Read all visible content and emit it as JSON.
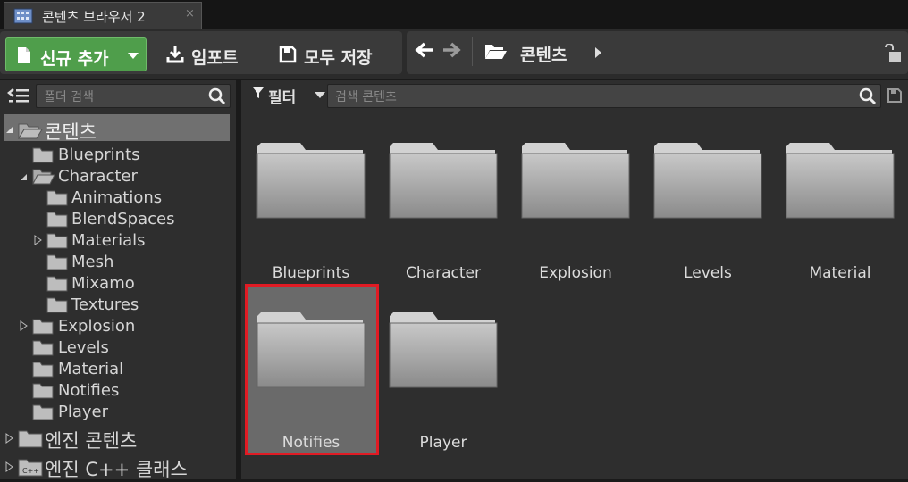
{
  "tab": {
    "title": "콘텐츠 브라우저 2",
    "close": "×"
  },
  "toolbar": {
    "new_label": "신규 추가",
    "import_label": "임포트",
    "save_all_label": "모두 저장",
    "breadcrumb": "콘텐츠"
  },
  "left": {
    "search_placeholder": "폴더 검색",
    "tree": [
      {
        "label": "콘텐츠"
      },
      {
        "label": "Blueprints"
      },
      {
        "label": "Character"
      },
      {
        "label": "Animations"
      },
      {
        "label": "BlendSpaces"
      },
      {
        "label": "Materials"
      },
      {
        "label": "Mesh"
      },
      {
        "label": "Mixamo"
      },
      {
        "label": "Textures"
      },
      {
        "label": "Explosion"
      },
      {
        "label": "Levels"
      },
      {
        "label": "Material"
      },
      {
        "label": "Notifies"
      },
      {
        "label": "Player"
      },
      {
        "label": "엔진 콘텐츠"
      },
      {
        "label": "엔진 C++ 클래스"
      }
    ]
  },
  "content": {
    "filter_label": "필터",
    "search_placeholder": "검색 콘텐츠",
    "folders": [
      {
        "name": "Blueprints"
      },
      {
        "name": "Character"
      },
      {
        "name": "Explosion"
      },
      {
        "name": "Levels"
      },
      {
        "name": "Material"
      },
      {
        "name": "Notifies"
      },
      {
        "name": "Player"
      }
    ]
  },
  "colors": {
    "accent_new": "#4f9e4b",
    "highlight": "#e01b24"
  }
}
